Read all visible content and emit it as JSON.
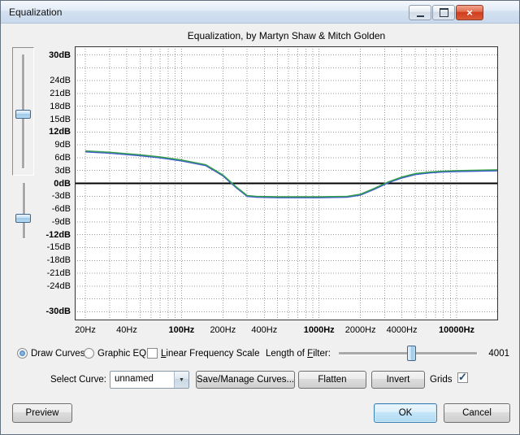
{
  "window": {
    "title": "Equalization",
    "close_glyph": "×"
  },
  "chart_data": {
    "type": "line",
    "title": "Equalization, by Martyn Shaw & Mitch Golden",
    "grid": true,
    "x_axis": {
      "scale": "log",
      "min": 20,
      "max": 20000,
      "tick_values": [
        20,
        40,
        100,
        200,
        400,
        1000,
        2000,
        4000,
        10000
      ],
      "tick_labels": [
        "20Hz",
        "40Hz",
        "100Hz",
        "200Hz",
        "400Hz",
        "1000Hz",
        "2000Hz",
        "4000Hz",
        "10000Hz"
      ],
      "bold_ticks": [
        100,
        1000,
        10000
      ],
      "grid_values": [
        20,
        30,
        40,
        50,
        60,
        70,
        80,
        90,
        100,
        200,
        300,
        400,
        500,
        600,
        700,
        800,
        900,
        1000,
        2000,
        3000,
        4000,
        5000,
        6000,
        7000,
        8000,
        9000,
        10000,
        20000
      ]
    },
    "y_axis": {
      "min": -30,
      "max": 30,
      "grid_step": 3,
      "tick_values": [
        30,
        24,
        21,
        18,
        15,
        12,
        9,
        6,
        3,
        0,
        -3,
        -6,
        -9,
        -12,
        -15,
        -18,
        -21,
        -24,
        -30
      ],
      "tick_labels": [
        "30dB",
        "24dB",
        "21dB",
        "18dB",
        "15dB",
        "12dB",
        "9dB",
        "6dB",
        "3dB",
        "0dB",
        "-3dB",
        "-6dB",
        "-9dB",
        "-12dB",
        "-15dB",
        "-18dB",
        "-21dB",
        "-24dB",
        "-30dB"
      ],
      "bold_ticks": [
        30,
        12,
        0,
        -12,
        -30
      ]
    },
    "zero_line_db": 0,
    "series": [
      {
        "name": "eq-curve",
        "colors": [
          "#3c59d1",
          "#35a04a"
        ],
        "points_hz_db": [
          [
            20,
            7.5
          ],
          [
            30,
            7.2
          ],
          [
            50,
            6.6
          ],
          [
            70,
            6.1
          ],
          [
            100,
            5.4
          ],
          [
            150,
            4.3
          ],
          [
            200,
            1.9
          ],
          [
            250,
            -0.9
          ],
          [
            300,
            -2.9
          ],
          [
            350,
            -3.1
          ],
          [
            500,
            -3.2
          ],
          [
            1000,
            -3.2
          ],
          [
            1600,
            -3.1
          ],
          [
            2000,
            -2.6
          ],
          [
            2500,
            -1.3
          ],
          [
            3200,
            0.3
          ],
          [
            4000,
            1.4
          ],
          [
            5000,
            2.2
          ],
          [
            6500,
            2.6
          ],
          [
            8000,
            2.8
          ],
          [
            10000,
            2.9
          ],
          [
            14000,
            3.0
          ],
          [
            20000,
            3.1
          ]
        ]
      }
    ]
  },
  "controls": {
    "draw_curves": {
      "label": "Draw Curves",
      "selected": true
    },
    "graphic_eq": {
      "label": "Graphic EQ",
      "selected": false
    },
    "linear_freq_scale": {
      "key": "L",
      "rest": "inear Frequency Scale",
      "checked": false
    },
    "length_of_filter": {
      "pre": "Length of ",
      "key": "F",
      "rest": "ilter:",
      "value": "4001"
    },
    "select_curve_label": "Select Curve:",
    "curve_select": {
      "value": "unnamed",
      "arrow_glyph": "▼"
    },
    "save_manage_label": "Save/Manage Curves...",
    "flatten_label": "Flatten",
    "invert_label": "Invert",
    "grids": {
      "label": "Grids",
      "checked": true,
      "check_glyph": "✓"
    }
  },
  "footer": {
    "preview_label": "Preview",
    "ok_label": "OK",
    "cancel_label": "Cancel"
  }
}
